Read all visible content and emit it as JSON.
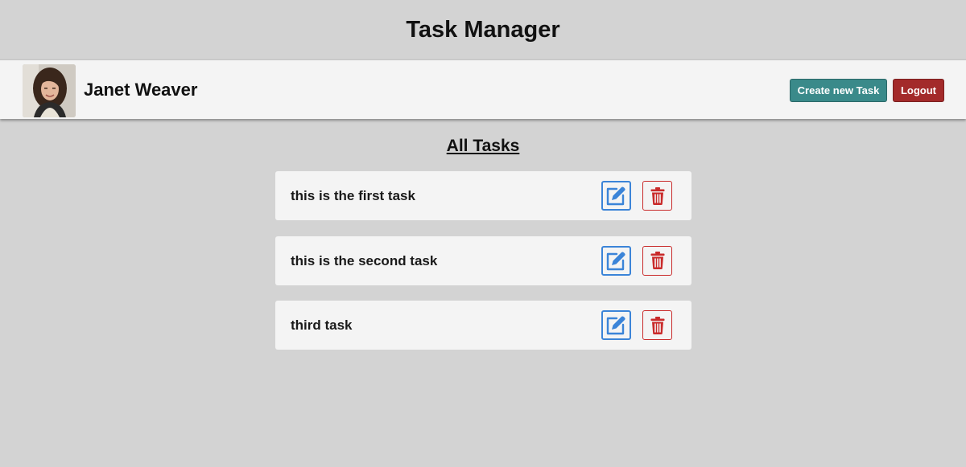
{
  "header": {
    "title": "Task Manager"
  },
  "user_bar": {
    "user_name": "Janet Weaver",
    "create_label": "Create new Task",
    "logout_label": "Logout"
  },
  "main": {
    "section_title": "All Tasks",
    "tasks": [
      {
        "text": "this is the first task"
      },
      {
        "text": "this is the second task"
      },
      {
        "text": "third task"
      }
    ]
  },
  "icons": {
    "edit": "edit-icon",
    "delete": "trash-icon"
  },
  "colors": {
    "background": "#d3d3d3",
    "create_button": "#3a8a8a",
    "logout_button": "#a32a2a",
    "edit_accent": "#3b84d8",
    "delete_accent": "#c92a2a"
  }
}
